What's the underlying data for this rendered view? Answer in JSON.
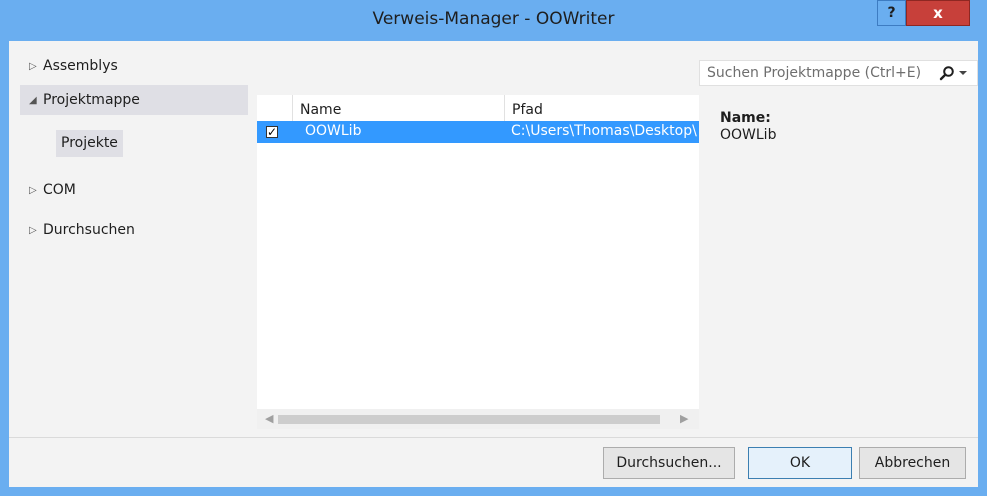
{
  "window": {
    "title": "Verweis-Manager - OOWriter",
    "help_label": "?",
    "close_label": "x"
  },
  "tree": {
    "items": [
      {
        "label": "Assemblys",
        "expanded": false
      },
      {
        "label": "Projektmappe",
        "expanded": true,
        "children": [
          "Projekte"
        ]
      },
      {
        "label": "COM",
        "expanded": false
      },
      {
        "label": "Durchsuchen",
        "expanded": false
      }
    ]
  },
  "search": {
    "placeholder": "Suchen Projektmappe (Ctrl+E)",
    "value": ""
  },
  "list": {
    "columns": [
      "Name",
      "Pfad"
    ],
    "rows": [
      {
        "checked": true,
        "name": "OOWLib",
        "path": "C:\\Users\\Thomas\\Desktop\\"
      }
    ]
  },
  "details": {
    "name_label": "Name:",
    "name_value": "OOWLib"
  },
  "buttons": {
    "browse": "Durchsuchen...",
    "ok": "OK",
    "cancel": "Abbrechen"
  },
  "colors": {
    "title_bar": "#6aaef0",
    "close": "#c7403a",
    "selection": "#3399ff",
    "tree_selected": "#dfdfe5"
  }
}
